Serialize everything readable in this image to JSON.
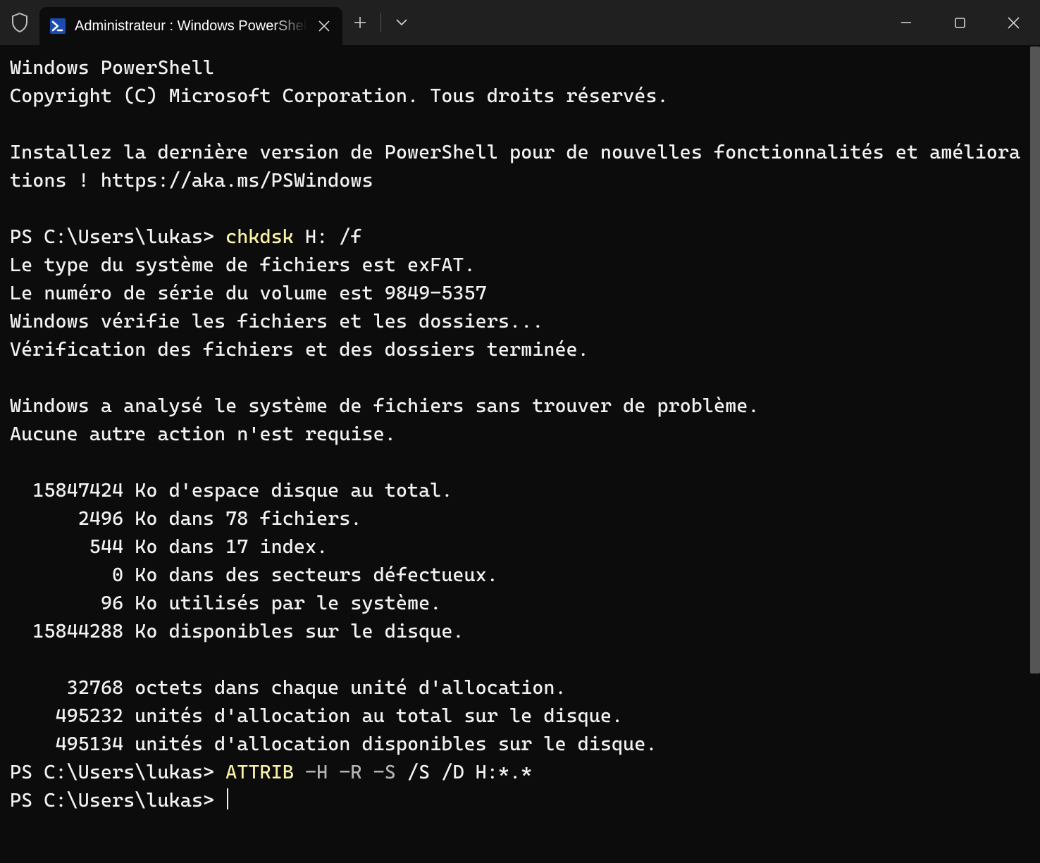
{
  "tab": {
    "title": "Administrateur : Windows PowerShell"
  },
  "terminal": {
    "line1": "Windows PowerShell",
    "line2": "Copyright (C) Microsoft Corporation. Tous droits réservés.",
    "blank1": "",
    "line3": "Installez la dernière version de PowerShell pour de nouvelles fonctionnalités et améliorations ! https://aka.ms/PSWindows",
    "blank2": "",
    "prompt1_prefix": "PS C:\\Users\\lukas> ",
    "prompt1_cmd": "chkdsk",
    "prompt1_args": " H: /f",
    "out1": "Le type du système de fichiers est exFAT.",
    "out2": "Le numéro de série du volume est 9849-5357",
    "out3": "Windows vérifie les fichiers et les dossiers...",
    "out4": "Vérification des fichiers et des dossiers terminée.",
    "blank3": "",
    "out5": "Windows a analysé le système de fichiers sans trouver de problème.",
    "out6": "Aucune autre action n'est requise.",
    "blank4": "",
    "out7": "  15847424 Ko d'espace disque au total.",
    "out8": "      2496 Ko dans 78 fichiers.",
    "out9": "       544 Ko dans 17 index.",
    "out10": "         0 Ko dans des secteurs défectueux.",
    "out11": "        96 Ko utilisés par le système.",
    "out12": "  15844288 Ko disponibles sur le disque.",
    "blank5": "",
    "out13": "     32768 octets dans chaque unité d'allocation.",
    "out14": "    495232 unités d'allocation au total sur le disque.",
    "out15": "    495134 unités d'allocation disponibles sur le disque.",
    "prompt2_prefix": "PS C:\\Users\\lukas> ",
    "prompt2_cmd": "ATTRIB",
    "prompt2_flag1": " -H",
    "prompt2_flag2": " -R",
    "prompt2_flag3": " -S",
    "prompt2_args": " /S /D H:*.*",
    "prompt3": "PS C:\\Users\\lukas> "
  }
}
